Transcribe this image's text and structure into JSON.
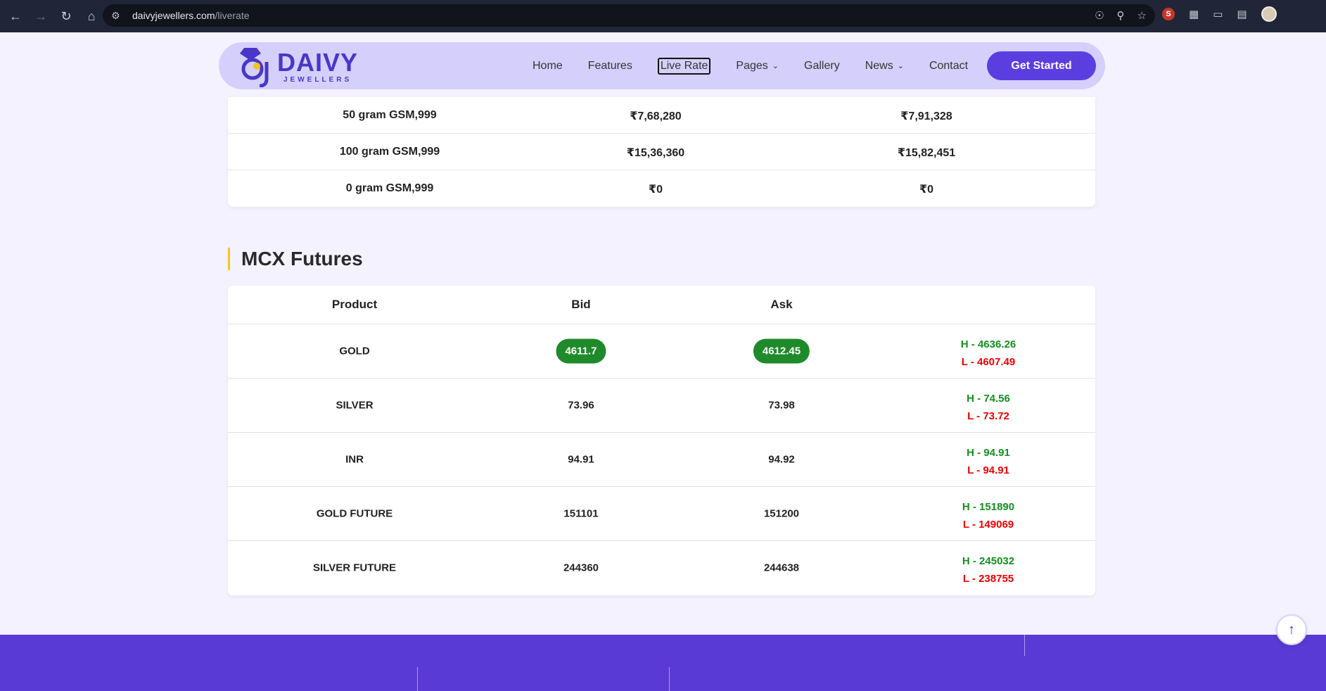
{
  "browser": {
    "url_domain": "daivyjewellers.com",
    "url_path": "/liverate"
  },
  "header": {
    "brand": "DAIVY",
    "brand_sub": "JEWELLERS",
    "menu": [
      {
        "label": "Home"
      },
      {
        "label": "Features"
      },
      {
        "label": "Live Rate"
      },
      {
        "label": "Pages"
      },
      {
        "label": "Gallery"
      },
      {
        "label": "News"
      },
      {
        "label": "Contact"
      }
    ],
    "cta": "Get Started"
  },
  "gsm_table": {
    "rows": [
      {
        "product": "50 gram GSM,999",
        "col2": "₹7,68,280",
        "col3": "₹7,91,328"
      },
      {
        "product": "100 gram GSM,999",
        "col2": "₹15,36,360",
        "col3": "₹15,82,451"
      },
      {
        "product": "0 gram GSM,999",
        "col2": "₹0",
        "col3": "₹0"
      }
    ]
  },
  "mcx": {
    "title": "MCX Futures",
    "headers": {
      "product": "Product",
      "bid": "Bid",
      "ask": "Ask"
    },
    "rows": [
      {
        "product": "GOLD",
        "bid": "4611.7",
        "ask": "4612.45",
        "high": "H - 4636.26",
        "low": "L - 4607.49"
      },
      {
        "product": "SILVER",
        "bid": "73.96",
        "ask": "73.98",
        "high": "H - 74.56",
        "low": "L - 73.72"
      },
      {
        "product": "INR",
        "bid": "94.91",
        "ask": "94.92",
        "high": "H - 94.91",
        "low": "L - 94.91"
      },
      {
        "product": "GOLD FUTURE",
        "bid": "151101",
        "ask": "151200",
        "high": "H - 151890",
        "low": "L - 149069"
      },
      {
        "product": "SILVER FUTURE",
        "bid": "244360",
        "ask": "244638",
        "high": "H - 245032",
        "low": "L - 238755"
      }
    ]
  },
  "colors": {
    "brand": "#5a3ee0",
    "highlight_green": "#1f8a2a",
    "high_text": "#13901e",
    "low_text": "#ee0000",
    "accent_bar": "#f5c518"
  },
  "icons": {
    "back": "arrow-left-icon",
    "forward": "arrow-right-icon",
    "reload": "reload-icon",
    "home": "home-icon",
    "scroll_top": "arrow-up-icon"
  }
}
